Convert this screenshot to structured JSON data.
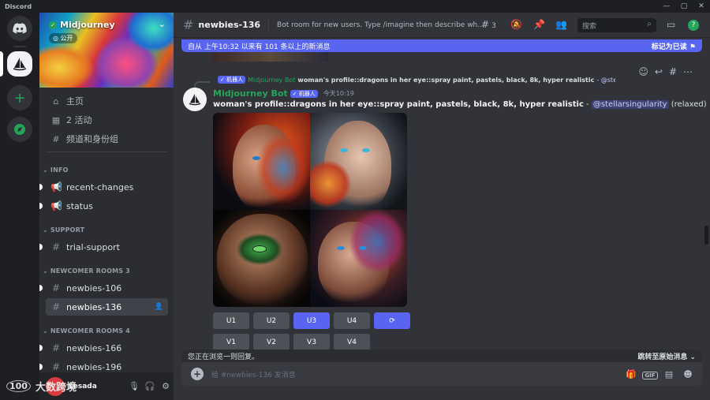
{
  "window": {
    "title": "Discord",
    "controls": [
      "—",
      "▢",
      "✕"
    ]
  },
  "rail": {
    "icons": [
      "discord-home-icon",
      "midjourney-server-icon",
      "add-server-icon",
      "explore-icon"
    ]
  },
  "server": {
    "name": "Midjourney",
    "visibility": "公开"
  },
  "nav": [
    {
      "icon": "home-icon",
      "label": "主页"
    },
    {
      "icon": "calendar-icon",
      "label": "2 活动"
    },
    {
      "icon": "channels-roles-icon",
      "label": "频道和身份组"
    }
  ],
  "categories": {
    "info": "INFO",
    "support": "SUPPORT",
    "rooms3": "NEWCOMER ROOMS 3",
    "rooms4": "NEWCOMER ROOMS 4"
  },
  "channels": {
    "recent_changes": "recent-changes",
    "status": "status",
    "trial_support": "trial-support",
    "newbies_106": "newbies-106",
    "newbies_136": "newbies-136",
    "newbies_166": "newbies-166",
    "newbies_196": "newbies-196"
  },
  "user": {
    "name": "Lesada"
  },
  "header": {
    "channel": "newbies-136",
    "topic": "Bot room for new users. Type /imagine then describe what yo...",
    "threads_count": "3",
    "search_placeholder": "搜索"
  },
  "new_messages_bar": {
    "text": "自从 上午10:32 以来有 101 条以上的新消息",
    "action": "标记为已读"
  },
  "reply": {
    "author": "Midjourney Bot",
    "bot_badge": "✓ 机器人",
    "text": "woman's profile::dragons in her eye::spray paint, pastels, black, 8k, hyper realistic",
    "mention": "- @stellar..."
  },
  "message": {
    "author": "Midjourney Bot",
    "bot_badge": "✓ 机器人",
    "time": "今天10:19",
    "prompt": "woman's profile::dragons in her eye::spray paint, pastels, black, 8k, hyper realistic",
    "dash": " - ",
    "mention": "@stellarsingularity",
    "mode": " (relaxed)"
  },
  "buttons_u": [
    "U1",
    "U2",
    "U3",
    "U4",
    "⟳"
  ],
  "buttons_v": [
    "V1",
    "V2",
    "V3",
    "V4"
  ],
  "composer": {
    "reply_notice": "您正在浏览一则回复。",
    "jump": "跳转至原始消息  ⌄",
    "placeholder": "给 #newbies-136 发消息",
    "gif_label": "GIF"
  },
  "watermark": {
    "logo": "100",
    "text": "大数跨境"
  },
  "colors": {
    "blurple": "#5865f2",
    "green": "#23a55a",
    "bg": "#313338",
    "sidebar": "#2b2d31"
  }
}
